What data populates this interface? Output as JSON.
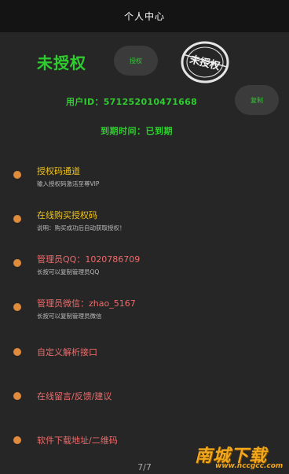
{
  "header": {
    "title": "个人中心"
  },
  "status": {
    "title": "未授权",
    "auth_button": "授权",
    "stamp_text": "未授权",
    "user_id": "用户ID：571252010471668",
    "copy_button": "复制",
    "expire": "到期时间：已到期"
  },
  "menu": [
    {
      "label": "授权码通道",
      "sub": "输入授权码激活至尊VIP",
      "color": "#f0c419"
    },
    {
      "label": "在线购买授权码",
      "sub": "说明：购买成功后自动获取授权！",
      "color": "#f0c419"
    },
    {
      "label": "管理员QQ：1020786709",
      "sub": "长按可以复制管理员QQ",
      "color": "#ee6b6b"
    },
    {
      "label": "管理员微信：zhao_5167",
      "sub": "长按可以复制管理员微信",
      "color": "#ee6b6b"
    },
    {
      "label": "自定义解析接口",
      "color": "#ee6b6b"
    },
    {
      "label": "在线留言/反馈/建议",
      "color": "#ee6b6b"
    },
    {
      "label": "软件下载地址/二维码",
      "color": "#ee6b6b"
    }
  ],
  "pager": {
    "text": "7/7"
  },
  "watermark": {
    "title": "南城下载",
    "url": "www.nccgcc.com"
  },
  "colors": {
    "accent": "#2ecc2e",
    "dot": "#e08a3c",
    "background": "#262626"
  }
}
